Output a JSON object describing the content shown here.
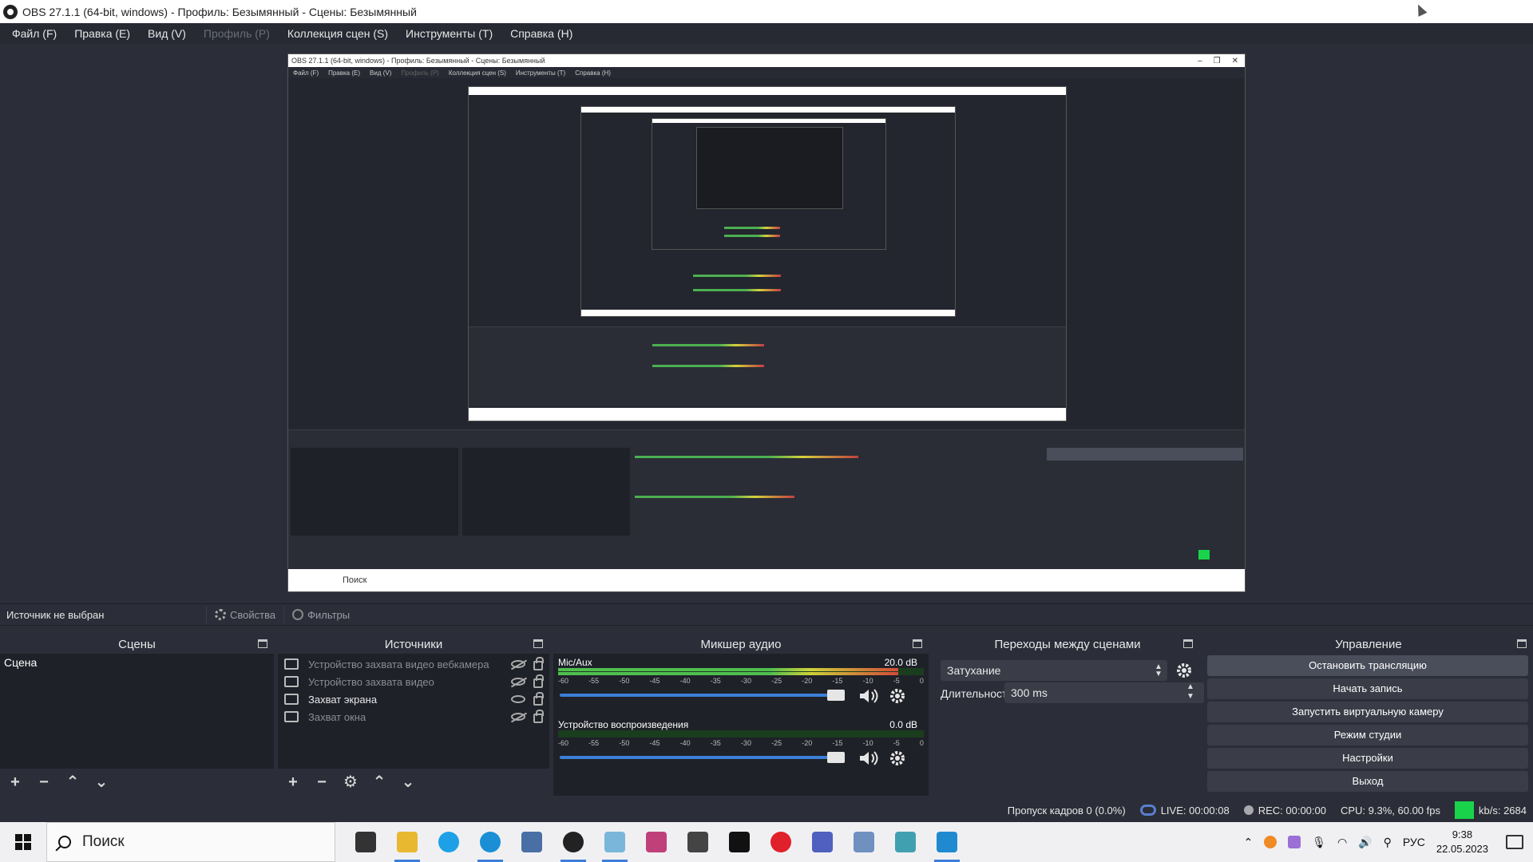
{
  "window": {
    "title": "OBS 27.1.1 (64-bit, windows) - Профиль: Безымянный - Сцены: Безымянный"
  },
  "menu": [
    {
      "label": "Файл (F)",
      "enabled": true
    },
    {
      "label": "Правка (E)",
      "enabled": true
    },
    {
      "label": "Вид (V)",
      "enabled": true
    },
    {
      "label": "Профиль (P)",
      "enabled": false
    },
    {
      "label": "Коллекция сцен (S)",
      "enabled": true
    },
    {
      "label": "Инструменты (T)",
      "enabled": true
    },
    {
      "label": "Справка (H)",
      "enabled": true
    }
  ],
  "preview": {
    "nested_title": "OBS 27.1.1 (64-bit, windows) - Профиль: Безымянный - Сцены: Безымянный",
    "nested_menu": [
      "Файл (F)",
      "Правка (E)",
      "Вид (V)",
      "Профиль (P)",
      "Коллекция сцен (S)",
      "Инструменты (T)",
      "Справка (H)"
    ],
    "nested_search": "Поиск"
  },
  "infobar": {
    "no_source": "Источник не выбран",
    "properties": "Свойства",
    "filters": "Фильтры"
  },
  "scenes": {
    "title": "Сцены",
    "items": [
      "Сцена"
    ]
  },
  "sources": {
    "title": "Источники",
    "items": [
      {
        "label": "Устройство захвата видео вебкамера",
        "visible": false,
        "icon": "camera-icon"
      },
      {
        "label": "Устройство захвата видео",
        "visible": false,
        "icon": "camera-icon"
      },
      {
        "label": "Захват экрана",
        "visible": true,
        "icon": "monitor-icon"
      },
      {
        "label": "Захват окна",
        "visible": false,
        "icon": "window-icon"
      }
    ]
  },
  "mixer": {
    "title": "Микшер аудио",
    "scale": [
      "-60",
      "-55",
      "-50",
      "-45",
      "-40",
      "-35",
      "-30",
      "-25",
      "-20",
      "-15",
      "-10",
      "-5",
      "0"
    ],
    "channels": [
      {
        "name": "Mic/Aux",
        "db": "20.0 dB",
        "level": 0.93,
        "volume": 0.98
      },
      {
        "name": "Устройство воспроизведения",
        "db": "0.0 dB",
        "level": 0.0,
        "volume": 0.98
      }
    ]
  },
  "transitions": {
    "title": "Переходы между сценами",
    "selected": "Затухание",
    "duration_label": "Длительность",
    "duration_value": "300 ms"
  },
  "controls": {
    "title": "Управление",
    "buttons": [
      "Остановить трансляцию",
      "Начать запись",
      "Запустить виртуальную камеру",
      "Режим студии",
      "Настройки",
      "Выход"
    ]
  },
  "status": {
    "dropped": "Пропуск кадров 0 (0.0%)",
    "live": "LIVE: 00:00:08",
    "rec": "REC: 00:00:00",
    "cpu": "CPU: 9.3%, 60.00 fps",
    "kbps": "kb/s: 2684"
  },
  "taskbar": {
    "search_placeholder": "Поиск",
    "apps": [
      {
        "name": "task-view-icon",
        "color": "#333333"
      },
      {
        "name": "file-explorer-icon",
        "color": "#e8b830"
      },
      {
        "name": "skype-icon",
        "color": "#1ea0e6"
      },
      {
        "name": "edge-icon",
        "color": "#1a8fd6"
      },
      {
        "name": "calculator-icon",
        "color": "#4a6fa5"
      },
      {
        "name": "obs-icon",
        "color": "#222222"
      },
      {
        "name": "paint-icon",
        "color": "#7ab6d9"
      },
      {
        "name": "books-icon",
        "color": "#c0407a"
      },
      {
        "name": "cube-icon",
        "color": "#444444"
      },
      {
        "name": "capcut-icon",
        "color": "#111111"
      },
      {
        "name": "opera-icon",
        "color": "#e0202a"
      },
      {
        "name": "link-icon",
        "color": "#5060c0"
      },
      {
        "name": "photo-icon",
        "color": "#7090c0"
      },
      {
        "name": "pen-icon",
        "color": "#40a0b0"
      },
      {
        "name": "window-app-icon",
        "color": "#1f8ad0"
      }
    ],
    "language": "РУС",
    "time": "9:38",
    "date": "22.05.2023"
  },
  "colors": {
    "background": "#2b2e38",
    "panel": "#1f2128",
    "button": "#3a3d47",
    "live_indicator": "#19d44b",
    "slider": "#3b7fd6"
  }
}
